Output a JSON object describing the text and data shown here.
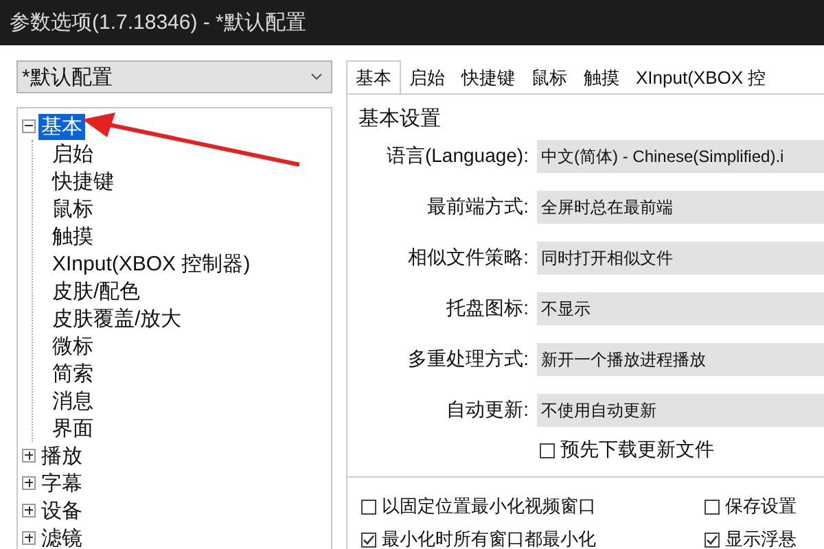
{
  "window": {
    "title": "参数选项(1.7.18346) - *默认配置"
  },
  "profile": {
    "value": "*默认配置"
  },
  "tree": [
    {
      "label": "基本",
      "selected": true,
      "expanded": true,
      "children": [
        {
          "label": "启始",
          "selected": false
        },
        {
          "label": "快捷键",
          "selected": false
        },
        {
          "label": "鼠标",
          "selected": false
        },
        {
          "label": "触摸",
          "selected": false
        },
        {
          "label": "XInput(XBOX 控制器)",
          "selected": false
        },
        {
          "label": "皮肤/配色",
          "selected": false
        },
        {
          "label": "皮肤覆盖/放大",
          "selected": false
        },
        {
          "label": "微标",
          "selected": false
        },
        {
          "label": "简索",
          "selected": false
        },
        {
          "label": "消息",
          "selected": false
        },
        {
          "label": "界面",
          "selected": false
        }
      ]
    },
    {
      "label": "播放",
      "selected": false,
      "expanded": false
    },
    {
      "label": "字幕",
      "selected": false,
      "expanded": false
    },
    {
      "label": "设备",
      "selected": false,
      "expanded": false
    },
    {
      "label": "滤镜",
      "selected": false,
      "expanded": false
    }
  ],
  "tabs": [
    {
      "label": "基本",
      "selected": true
    },
    {
      "label": "启始",
      "selected": false
    },
    {
      "label": "快捷键",
      "selected": false
    },
    {
      "label": "鼠标",
      "selected": false
    },
    {
      "label": "触摸",
      "selected": false
    },
    {
      "label": "XInput(XBOX 控",
      "selected": false
    }
  ],
  "group": {
    "title": "基本设置",
    "fields": [
      {
        "label": "语言(Language):",
        "value": "中文(简体) - Chinese(Simplified).i"
      },
      {
        "label": "最前端方式:",
        "value": "全屏时总在最前端"
      },
      {
        "label": "相似文件策略:",
        "value": "同时打开相似文件"
      },
      {
        "label": "托盘图标:",
        "value": "不显示"
      },
      {
        "label": "多重处理方式:",
        "value": "新开一个播放进程播放"
      },
      {
        "label": "自动更新:",
        "value": "不使用自动更新"
      }
    ],
    "update_option": {
      "label": "预先下载更新文件",
      "checked": false
    }
  },
  "options": [
    {
      "label": "以固定位置最小化视频窗口",
      "checked": false
    },
    {
      "label": "保存设置",
      "checked": false
    },
    {
      "label": "最小化时所有窗口都最小化",
      "checked": true
    },
    {
      "label": "显示浮悬",
      "checked": true
    }
  ]
}
